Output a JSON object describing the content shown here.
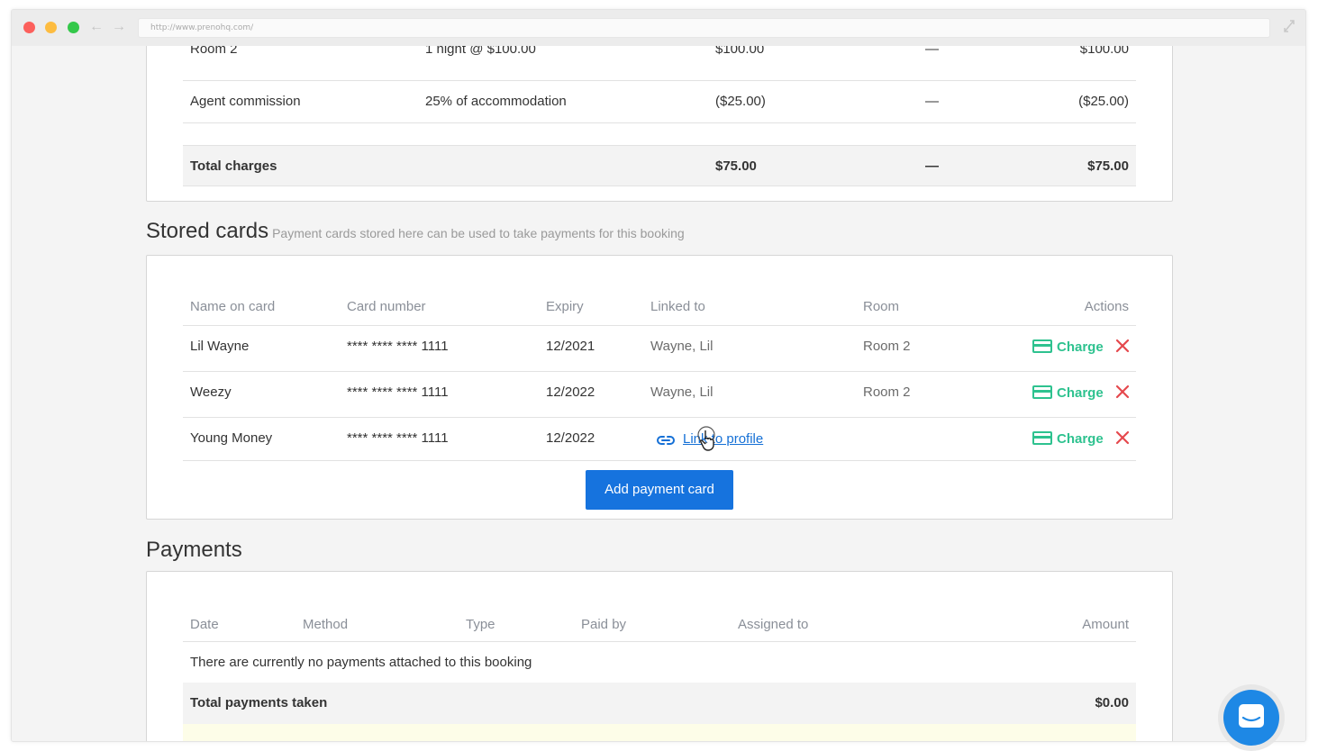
{
  "browser": {
    "url": "http://www.prenohq.com/"
  },
  "charges": {
    "rows": [
      {
        "name": "Room 2",
        "desc": "1 night @ $100.00",
        "amount": "$100.00",
        "tax": "—",
        "total": "$100.00"
      },
      {
        "name": "Agent commission",
        "desc": "25% of accommodation",
        "amount": "($25.00)",
        "tax": "—",
        "total": "($25.00)"
      }
    ],
    "total": {
      "label": "Total charges",
      "amount": "$75.00",
      "tax": "—",
      "total": "$75.00"
    }
  },
  "stored_cards": {
    "title": "Stored cards",
    "subtitle": "Payment cards stored here can be used to take payments for this booking",
    "headers": {
      "name": "Name on card",
      "number": "Card number",
      "expiry": "Expiry",
      "linked": "Linked to",
      "room": "Room",
      "actions": "Actions"
    },
    "rows": [
      {
        "name": "Lil Wayne",
        "number": "**** **** **** 1111",
        "expiry": "12/2021",
        "linked": "Wayne, Lil",
        "room": "Room 2",
        "action": "Charge"
      },
      {
        "name": "Weezy",
        "number": "**** **** **** 1111",
        "expiry": "12/2022",
        "linked": "Wayne, Lil",
        "room": "Room 2",
        "action": "Charge"
      },
      {
        "name": "Young Money",
        "number": "**** **** **** 1111",
        "expiry": "12/2022",
        "link_label": "Link to profile",
        "action": "Charge"
      }
    ],
    "add_button": "Add payment card"
  },
  "payments": {
    "title": "Payments",
    "headers": {
      "date": "Date",
      "method": "Method",
      "type": "Type",
      "paid_by": "Paid by",
      "assigned": "Assigned to",
      "amount": "Amount"
    },
    "empty_text": "There are currently no payments attached to this booking",
    "total_label": "Total payments taken",
    "total_amount": "$0.00"
  },
  "colors": {
    "primary": "#1673de",
    "charge": "#2ec28f",
    "delete": "#e5484d",
    "link": "#1570d6"
  }
}
